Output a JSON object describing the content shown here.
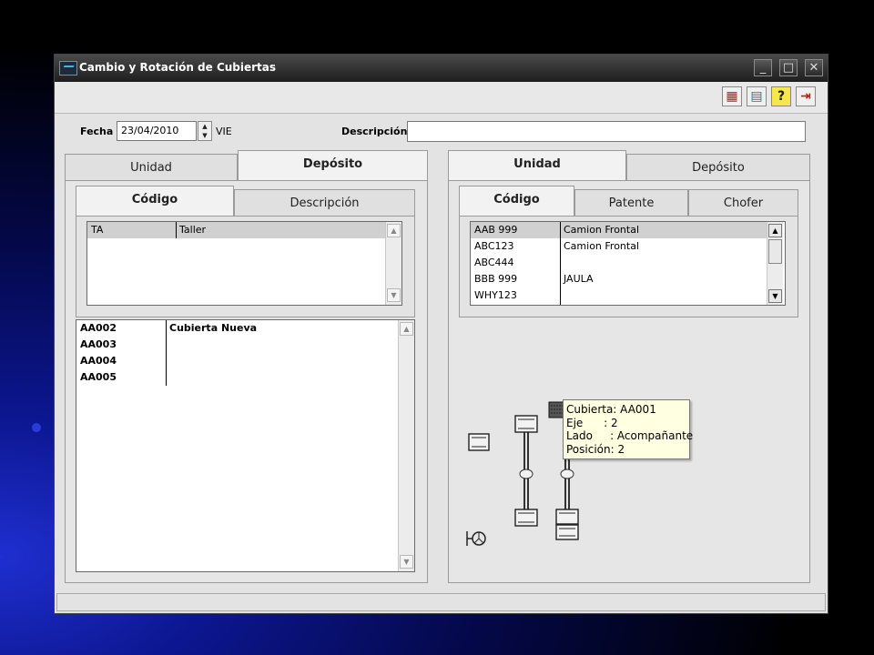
{
  "window": {
    "title": "Cambio y Rotación de Cubiertas"
  },
  "titlebar_buttons": {
    "minimize": "_",
    "maximize": "□",
    "close": "✕"
  },
  "toolbar": {
    "btn1_glyph": "▦",
    "btn2_glyph": "▤",
    "help_glyph": "?",
    "exit_glyph": "⇥"
  },
  "form": {
    "fecha_label": "Fecha",
    "fecha_value": "23/04/2010",
    "weekday": "VIE",
    "descripcion_label": "Descripción",
    "descripcion_value": ""
  },
  "left_panel": {
    "outer_tabs": [
      {
        "label": "Unidad"
      },
      {
        "label": "Depósito"
      }
    ],
    "inner_tabs": [
      {
        "label": "Código"
      },
      {
        "label": "Descripción"
      }
    ],
    "deposits": [
      {
        "code": "TA",
        "name": "Taller"
      }
    ],
    "tires": [
      {
        "code": "AA002",
        "desc": "Cubierta Nueva"
      },
      {
        "code": "AA003",
        "desc": ""
      },
      {
        "code": "AA004",
        "desc": ""
      },
      {
        "code": "AA005",
        "desc": ""
      }
    ]
  },
  "right_panel": {
    "outer_tabs": [
      {
        "label": "Unidad"
      },
      {
        "label": "Depósito"
      }
    ],
    "inner_tabs": [
      {
        "label": "Código"
      },
      {
        "label": "Patente"
      },
      {
        "label": "Chofer"
      }
    ],
    "units": [
      {
        "code": "AAB 999",
        "name": "Camion Frontal"
      },
      {
        "code": "ABC123",
        "name": "Camion Frontal"
      },
      {
        "code": "ABC444",
        "name": ""
      },
      {
        "code": "BBB 999",
        "name": "JAULA"
      },
      {
        "code": "WHY123",
        "name": ""
      }
    ],
    "tooltip": {
      "cubierta": "Cubierta: AA001",
      "eje": "Eje      : 2",
      "lado": "Lado     : Acompañante",
      "posicion": "Posición: 2"
    }
  },
  "colors": {
    "titlebar": "#2e2e2e",
    "window_bg": "#e3e3e3",
    "tooltip_bg": "#ffffe1",
    "selected_row": "#d0d0d0"
  }
}
